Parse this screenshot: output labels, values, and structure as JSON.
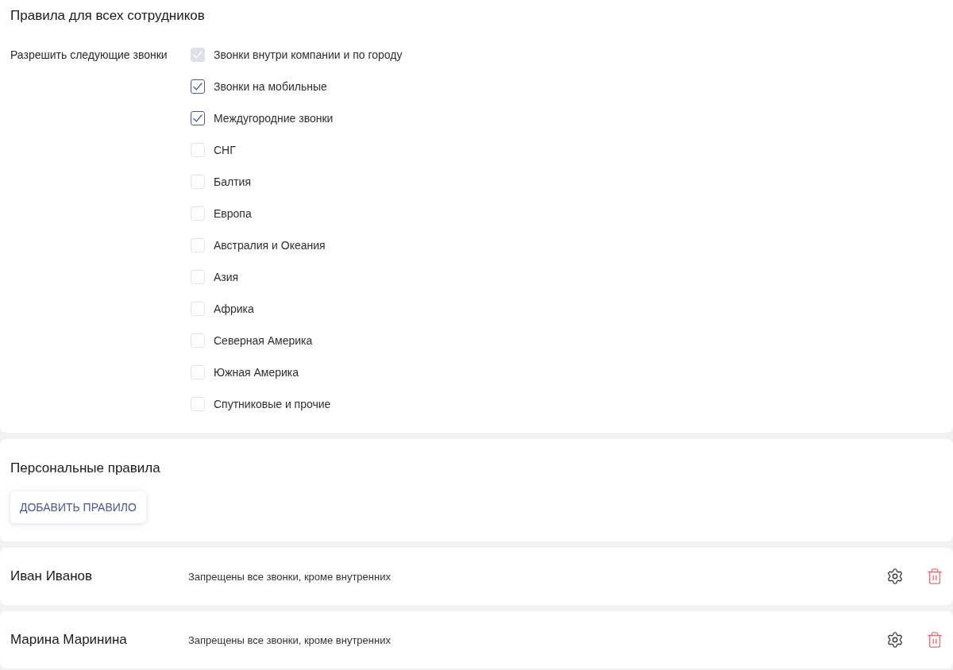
{
  "all_rules": {
    "title": "Правила для всех сотрудников",
    "label": "Разрешить следующие звонки",
    "options": [
      {
        "label": "Звонки внутри компании и по городу",
        "checked": true,
        "disabled": true
      },
      {
        "label": "Звонки на мобильные",
        "checked": true,
        "disabled": false
      },
      {
        "label": "Междугородние звонки",
        "checked": true,
        "disabled": false
      },
      {
        "label": "СНГ",
        "checked": false,
        "disabled": false
      },
      {
        "label": "Балтия",
        "checked": false,
        "disabled": false
      },
      {
        "label": "Европа",
        "checked": false,
        "disabled": false
      },
      {
        "label": "Австралия и Океания",
        "checked": false,
        "disabled": false
      },
      {
        "label": "Азия",
        "checked": false,
        "disabled": false
      },
      {
        "label": "Африка",
        "checked": false,
        "disabled": false
      },
      {
        "label": "Северная Америка",
        "checked": false,
        "disabled": false
      },
      {
        "label": "Южная Америка",
        "checked": false,
        "disabled": false
      },
      {
        "label": "Спутниковые и прочие",
        "checked": false,
        "disabled": false
      }
    ]
  },
  "personal_rules": {
    "title": "Персональные правила",
    "add_button": "ДОБАВИТЬ ПРАВИЛО"
  },
  "rules": [
    {
      "name": "Иван Иванов",
      "description": "Запрещены все звонки, кроме внутренних"
    },
    {
      "name": "Марина Маринина",
      "description": "Запрещены все звонки, кроме внутренних"
    }
  ]
}
